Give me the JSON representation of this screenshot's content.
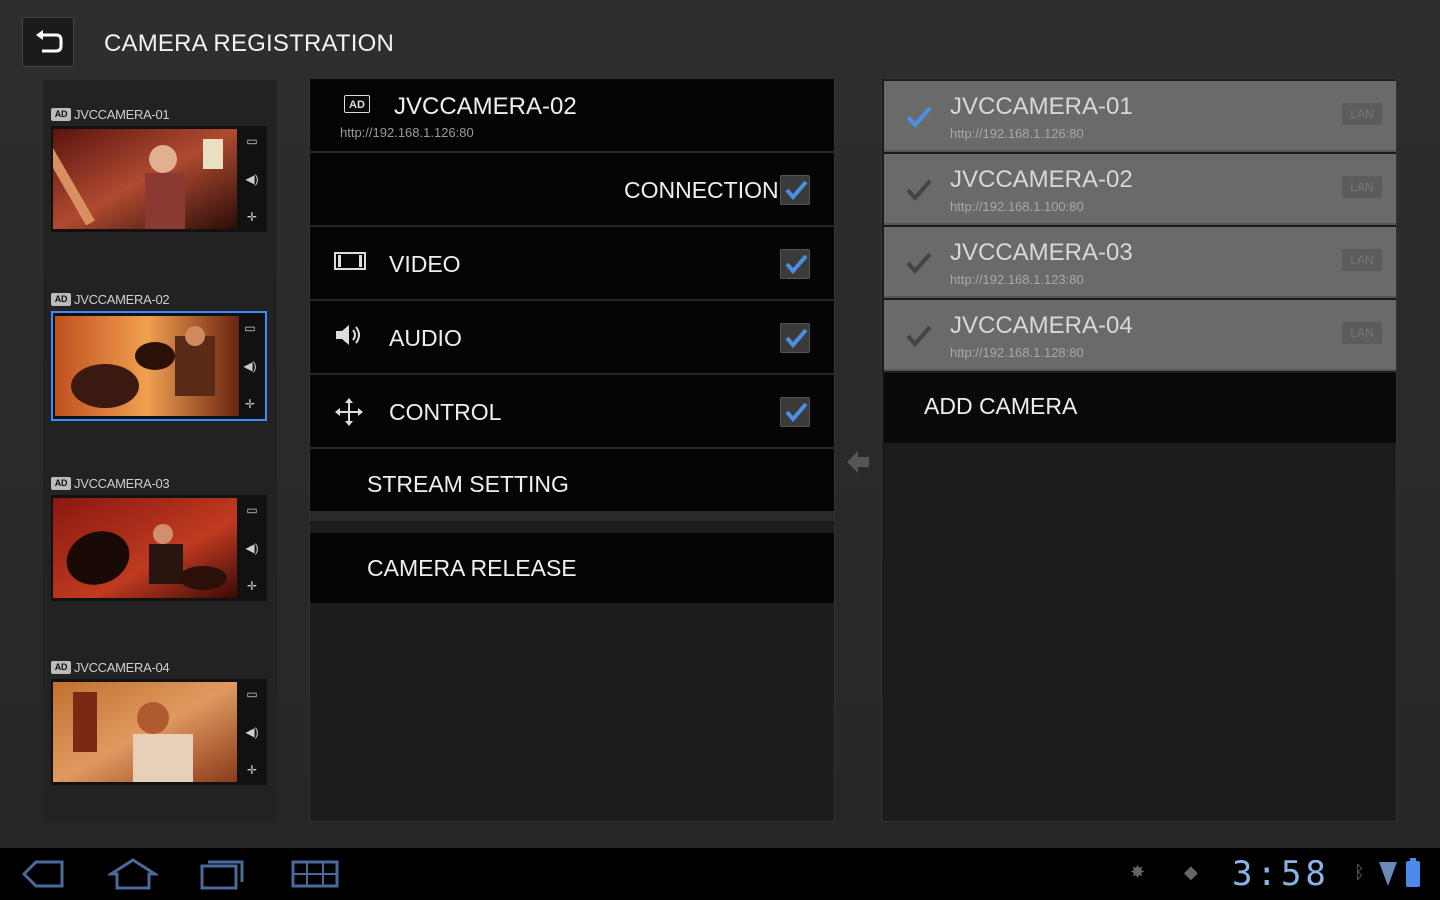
{
  "header": {
    "title": "CAMERA REGISTRATION"
  },
  "thumbnails": [
    {
      "label": "JVCCAMERA-01",
      "badge": "AD",
      "selected": false
    },
    {
      "label": "JVCCAMERA-02",
      "badge": "AD",
      "selected": true
    },
    {
      "label": "JVCCAMERA-03",
      "badge": "AD",
      "selected": false
    },
    {
      "label": "JVCCAMERA-04",
      "badge": "AD",
      "selected": false
    }
  ],
  "settings": {
    "camera_name": "JVCCAMERA-02",
    "camera_url": "http://192.168.1.126:80",
    "badge": "AD",
    "connection_label": "CONNECTION",
    "video_label": "VIDEO",
    "audio_label": "AUDIO",
    "control_label": "CONTROL",
    "stream_setting_label": "STREAM SETTING",
    "camera_release_label": "CAMERA RELEASE",
    "connection_checked": true,
    "video_checked": true,
    "audio_checked": true,
    "control_checked": true
  },
  "camera_list": [
    {
      "name": "JVCCAMERA-01",
      "url": "http://192.168.1.126:80",
      "tag": "LAN",
      "active": true
    },
    {
      "name": "JVCCAMERA-02",
      "url": "http://192.168.1.100:80",
      "tag": "LAN",
      "active": false
    },
    {
      "name": "JVCCAMERA-03",
      "url": "http://192.168.1.123:80",
      "tag": "LAN",
      "active": false
    },
    {
      "name": "JVCCAMERA-04",
      "url": "http://192.168.1.128:80",
      "tag": "LAN",
      "active": false
    }
  ],
  "add_camera_label": "ADD CAMERA",
  "system_bar": {
    "clock": "3:58"
  },
  "colors": {
    "accent": "#3d8bff",
    "check_active": "#4a90e2",
    "check_inactive": "#444444"
  },
  "icons": {
    "back": "back-arrow-icon",
    "video": "film-icon",
    "audio": "speaker-icon",
    "control": "move-arrows-icon"
  }
}
